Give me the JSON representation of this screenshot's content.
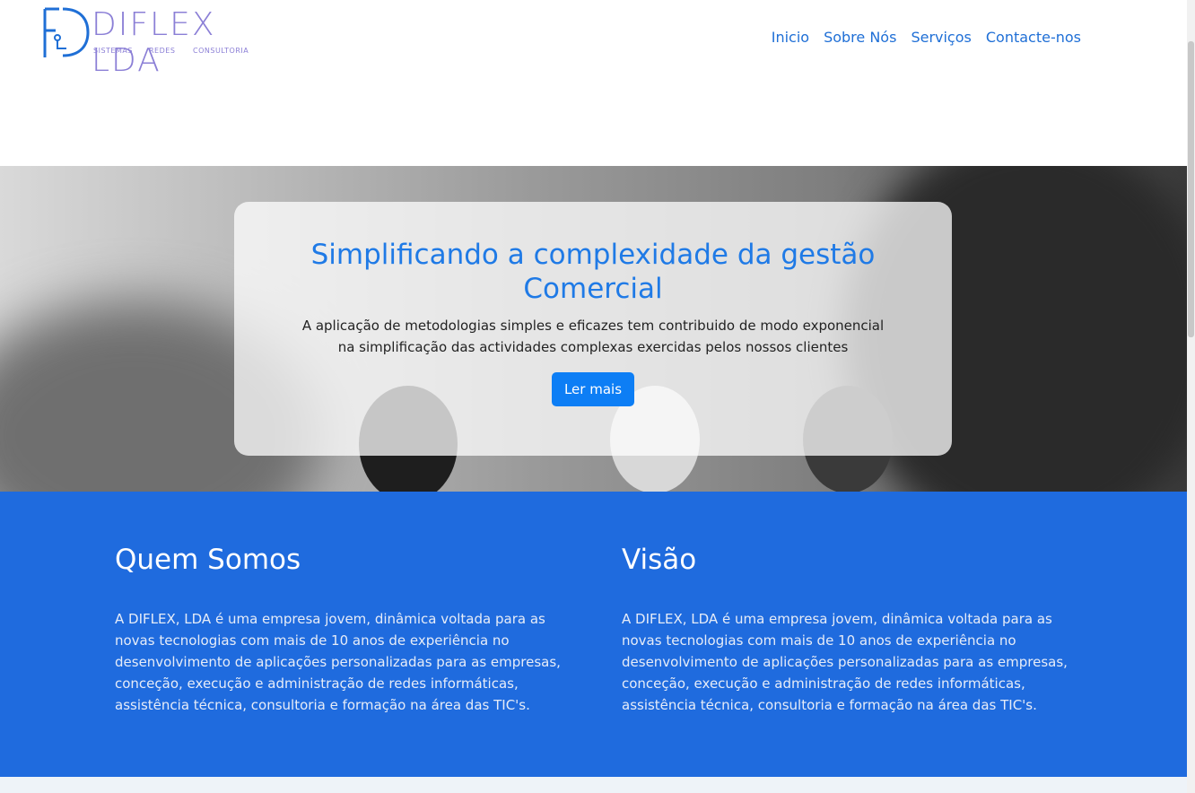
{
  "header": {
    "logo": {
      "wordmark": "DIFLEX LDA",
      "tagline": [
        "SISTEMAS",
        "REDES",
        "CONSULTORIA"
      ],
      "color": "#8b7fd6",
      "accent": "#1f6fd6"
    },
    "nav": [
      {
        "label": "Inicio"
      },
      {
        "label": "Sobre Nós"
      },
      {
        "label": "Serviços"
      },
      {
        "label": "Contacte-nos"
      }
    ]
  },
  "hero": {
    "title": "Simplificando a complexidade da gestão Comercial",
    "description": "A aplicação de metodologias simples e eficazes tem contribuido de modo exponencial na simplificação das actividades complexas exercidas pelos nossos clientes",
    "button_label": "Ler mais",
    "image": "black-and-white-people-smiling-photo"
  },
  "about": {
    "left": {
      "heading": "Quem Somos",
      "text": "A DIFLEX, LDA é uma empresa jovem, dinâmica voltada para as novas tecnologias com mais de 10 anos de experiência no desenvolvimento de aplicações personalizadas para as empresas, conceção, execução e administração de redes informáticas, assistência técnica, consultoria e formação na área das TIC's."
    },
    "right": {
      "heading": "Visão",
      "text": "A DIFLEX, LDA é uma empresa jovem, dinâmica voltada para as novas tecnologias com mais de 10 anos de experiência no desenvolvimento de aplicações personalizadas para as empresas, conceção, execução e administração de redes informáticas, assistência técnica, consultoria e formação na área das TIC's."
    }
  },
  "colors": {
    "primary": "#1f6bde",
    "button": "#0d7ef5",
    "link": "#1f6fd6"
  }
}
